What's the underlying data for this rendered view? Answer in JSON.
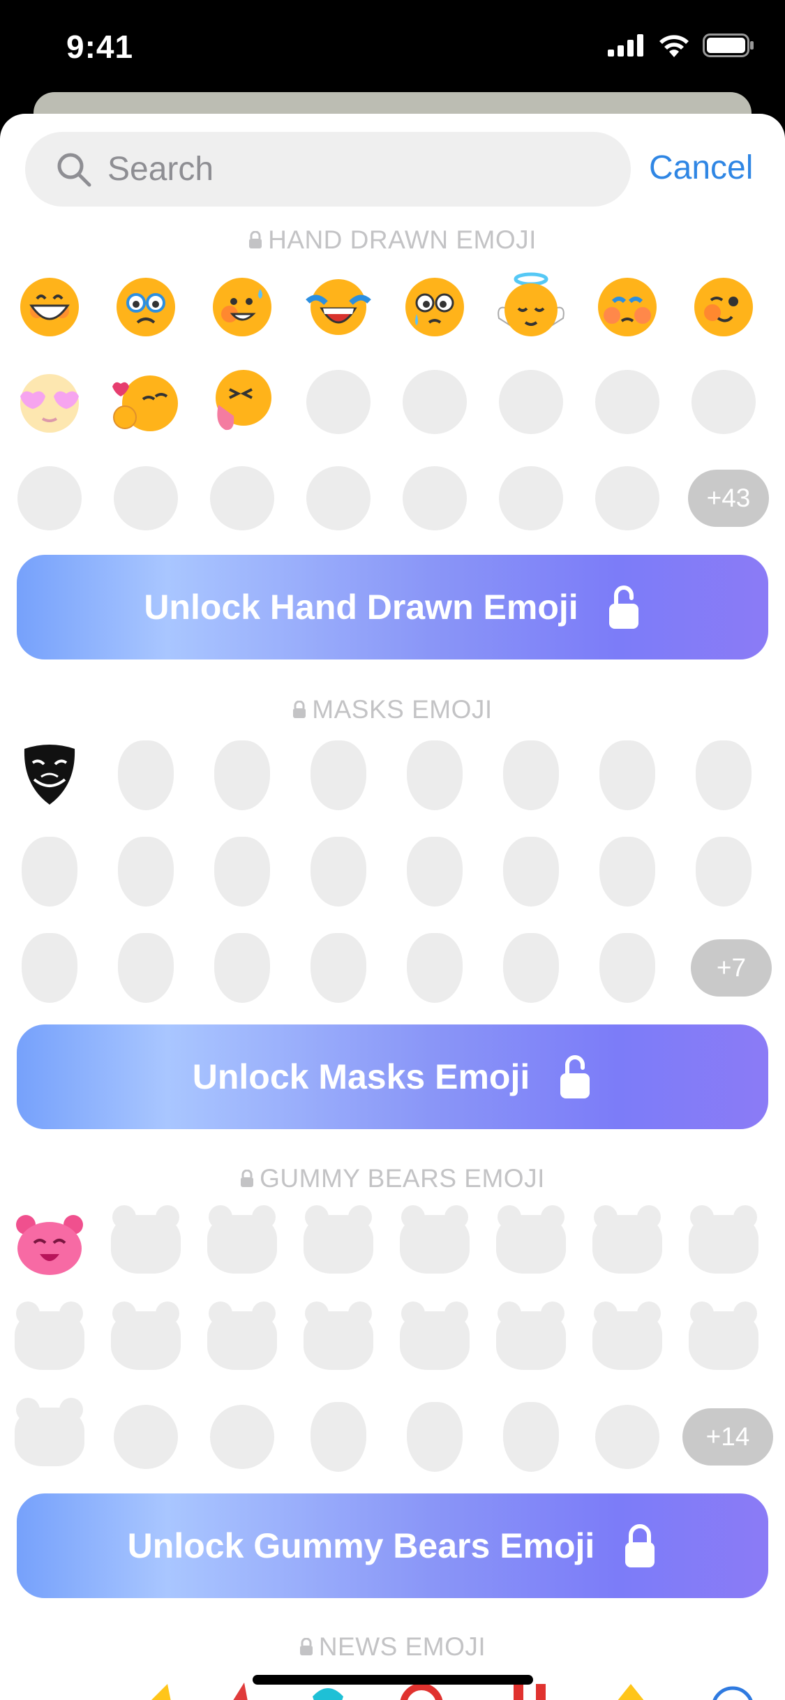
{
  "status_bar": {
    "time": "9:41"
  },
  "search": {
    "placeholder": "Search",
    "cancel_label": "Cancel"
  },
  "sections": [
    {
      "title": "HAND DRAWN EMOJI",
      "more_count": "+43",
      "unlock_label": "Unlock Hand Drawn Emoji"
    },
    {
      "title": "MASKS EMOJI",
      "more_count": "+7",
      "unlock_label": "Unlock Masks Emoji"
    },
    {
      "title": "GUMMY BEARS EMOJI",
      "more_count": "+14",
      "unlock_label": "Unlock Gummy Bears Emoji"
    },
    {
      "title": "NEWS EMOJI"
    }
  ],
  "colors": {
    "accent": "#2f86e4",
    "placeholder": "#ececec",
    "badge": "#c9c9c9"
  },
  "icons": [
    "search-icon",
    "lock-icon",
    "unlock-icon",
    "signal-icon",
    "wifi-icon",
    "battery-icon"
  ]
}
